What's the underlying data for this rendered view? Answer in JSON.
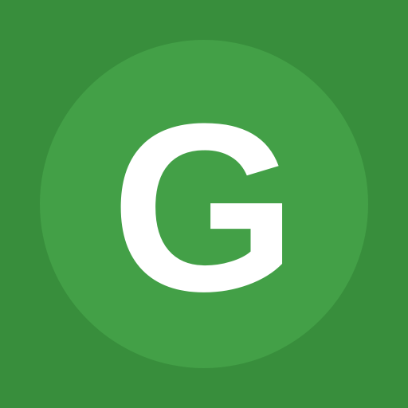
{
  "avatar": {
    "letter": "G",
    "background_color": "#388e3c",
    "circle_color": "#43a047",
    "letter_color": "#ffffff"
  }
}
